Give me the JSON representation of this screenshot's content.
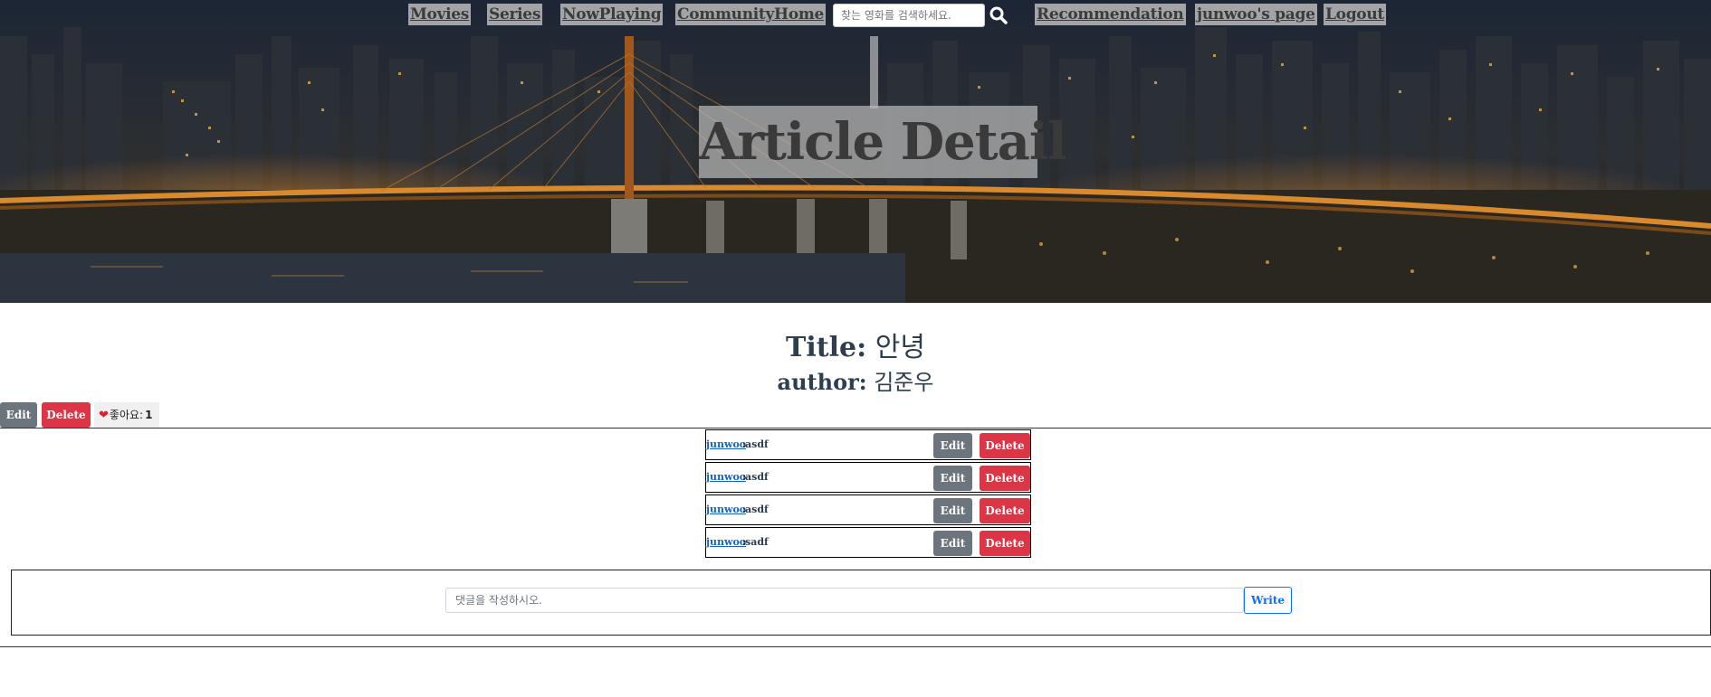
{
  "nav": {
    "links": [
      "Movies",
      "Series",
      "NowPlaying",
      "CommunityHome"
    ],
    "search_placeholder": "찾는 영화를 검색하세요.",
    "right_links": [
      "Recommendation",
      "junwoo's page",
      "Logout"
    ]
  },
  "hero": {
    "title": "Article Detail"
  },
  "article": {
    "title_label": "Title:",
    "title_value": "안녕",
    "author_label": "author:",
    "author_value": "김준우",
    "edit_label": "Edit",
    "delete_label": "Delete",
    "like_label": "좋아요:",
    "like_count": "1"
  },
  "comments": [
    {
      "user": "junwoo",
      "separator": ":",
      "content": "asdf",
      "edit": "Edit",
      "delete": "Delete"
    },
    {
      "user": "junwoo",
      "separator": ":",
      "content": "asdf",
      "edit": "Edit",
      "delete": "Delete"
    },
    {
      "user": "junwoo",
      "separator": ":",
      "content": "asdf",
      "edit": "Edit",
      "delete": "Delete"
    },
    {
      "user": "junwoo",
      "separator": ":",
      "content": "sadf",
      "edit": "Edit",
      "delete": "Delete"
    }
  ],
  "comment_form": {
    "placeholder": "댓글을 작성하시오.",
    "write_label": "Write"
  },
  "colors": {
    "danger": "#dc3545",
    "secondary": "#6c757d",
    "primary": "#0d6efd",
    "text": "#2c3e50"
  }
}
